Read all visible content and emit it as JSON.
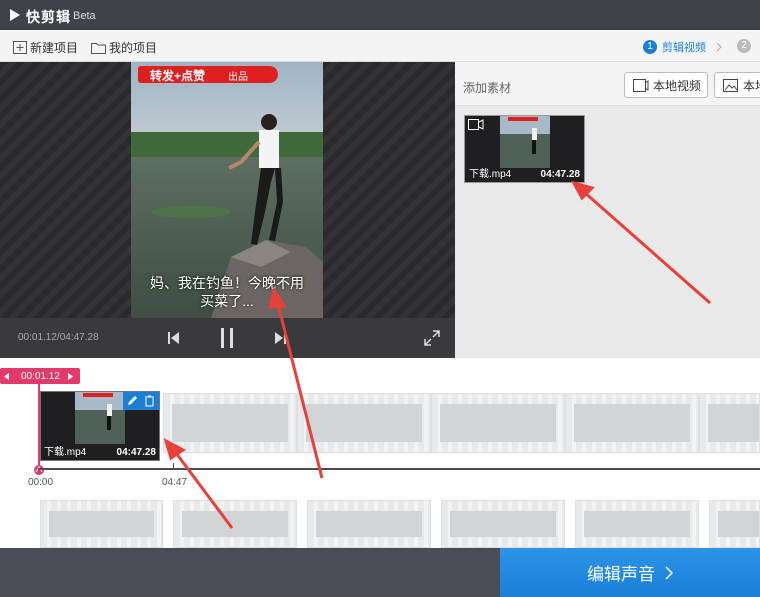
{
  "app": {
    "title": "快剪辑",
    "beta": "Beta"
  },
  "toolbar": {
    "new_project": "新建项目",
    "my_projects": "我的项目"
  },
  "steps": [
    {
      "num": "1",
      "label": "剪辑视频"
    },
    {
      "num": "2",
      "label": ""
    }
  ],
  "preview": {
    "banner_text": "转发+点赞",
    "banner_suffix": "出品",
    "subtitle_line1": "妈、我在钓鱼！今晚不用",
    "subtitle_line2": "买菜了...",
    "time": "00:01.12/04:47.28"
  },
  "materials": {
    "label": "添加素材",
    "local_video": "本地视频",
    "local_image": "本地"
  },
  "clip": {
    "name": "下载.mp4",
    "duration": "04:47.28"
  },
  "timeline": {
    "playhead_time": "00:01.12",
    "tick_start": "00:00",
    "tick_mid": "04:47",
    "clip_name": "下载.mp4",
    "clip_duration": "04:47.28"
  },
  "footer": {
    "edit_sound": "编辑声音"
  },
  "colors": {
    "accent": "#1b7fd6",
    "playhead": "#e23b6b",
    "annotation_arrow": "#e8403a"
  }
}
